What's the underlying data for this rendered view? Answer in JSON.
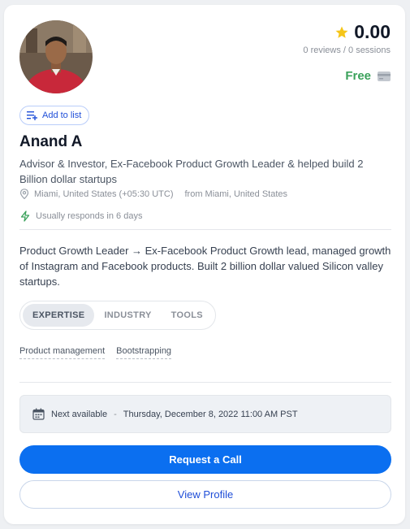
{
  "profile": {
    "name": "Anand A",
    "headline": "Advisor & Investor, Ex-Facebook Product Growth Leader & helped build 2 Billion dollar startups",
    "location": "Miami, United States (+05:30 UTC)",
    "from": "from Miami, United States",
    "response": "Usually responds in 6 days",
    "bio": "Product Growth Leader → Ex-Facebook Product Growth lead, managed growth of Instagram and Facebook products. Built 2 billion dollar valued Silicon valley startups."
  },
  "rating": {
    "value": "0.00",
    "summary": "0 reviews / 0 sessions",
    "price": "Free"
  },
  "actions": {
    "add_to_list": "Add to list",
    "request_call": "Request a Call",
    "view_profile": "View Profile"
  },
  "tabs": [
    {
      "label": "EXPERTISE",
      "active": true
    },
    {
      "label": "INDUSTRY",
      "active": false
    },
    {
      "label": "TOOLS",
      "active": false
    }
  ],
  "tags": [
    "Product management",
    "Bootstrapping"
  ],
  "availability": {
    "label": "Next available",
    "separator": "-",
    "datetime": "Thursday, December 8, 2022 11:00 AM PST"
  },
  "colors": {
    "primary": "#0b6ff0",
    "price_green": "#3aa15a",
    "star": "#f5c518"
  },
  "icons": {
    "rating": "star-icon",
    "price": "card-icon",
    "add_list": "playlist-add-icon",
    "location": "location-pin-icon",
    "response": "lightning-icon",
    "calendar": "calendar-icon"
  }
}
